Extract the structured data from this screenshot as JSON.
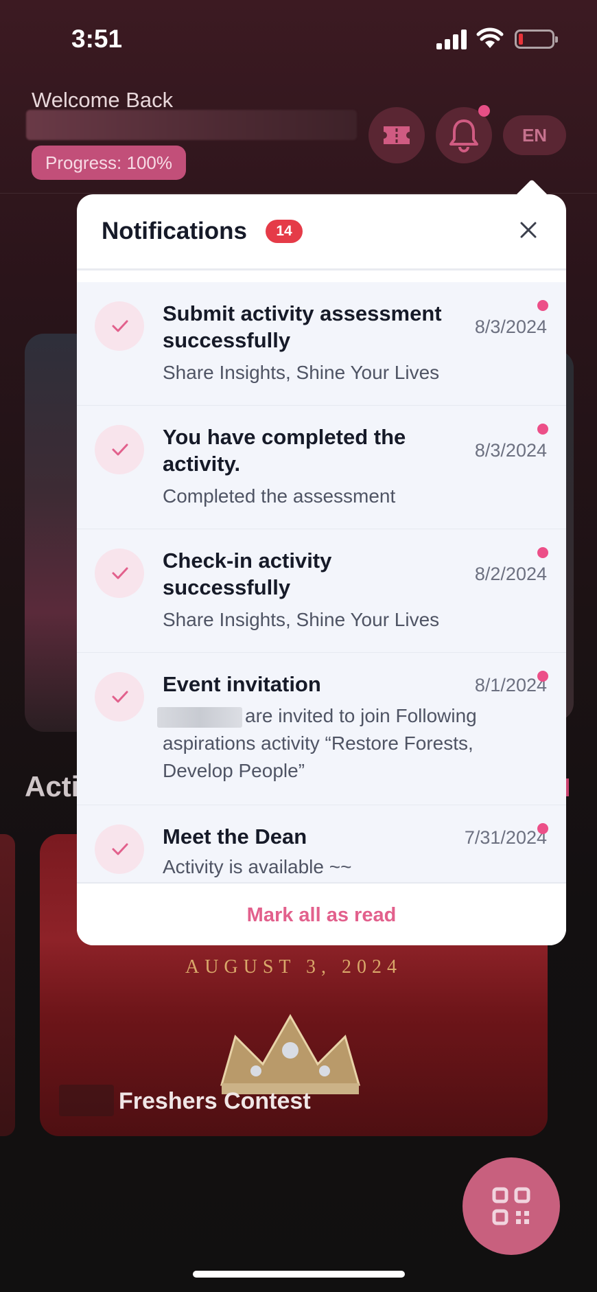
{
  "status_bar": {
    "time": "3:51"
  },
  "header": {
    "welcome": "Welcome Back",
    "progress": "Progress: 100%",
    "language": "EN"
  },
  "background": {
    "section_title": "Acti",
    "event_date": "AUGUST 3, 2024",
    "event_title": "Freshers Contest"
  },
  "notifications": {
    "title": "Notifications",
    "count": "14",
    "items": [
      {
        "title": "Submit activity assessment successfully",
        "date": "8/3/2024",
        "body": "Share Insights, Shine Your Lives",
        "unread": true
      },
      {
        "title": "You have completed the activity.",
        "date": "8/3/2024",
        "body": "Completed the assessment",
        "unread": true
      },
      {
        "title": "Check-in activity successfully",
        "date": "8/2/2024",
        "body": "Share Insights, Shine Your Lives",
        "unread": true
      },
      {
        "title": "Event invitation",
        "date": "8/1/2024",
        "body": "are invited to join Following aspirations activity “Restore Forests, Develop People”",
        "unread": true
      },
      {
        "title": "Meet the Dean",
        "date": "7/31/2024",
        "body": "Activity is available ~~",
        "unread": true
      }
    ],
    "mark_all": "Mark all as read"
  },
  "colors": {
    "accent": "#e2608c",
    "unread_dot": "#ec4f88",
    "badge": "#e53b48",
    "fab": "#c8607e"
  },
  "icons": [
    "ticket-icon",
    "bell-icon",
    "close-icon",
    "check-icon",
    "qr-code-icon",
    "signal-icon",
    "wifi-icon",
    "battery-icon"
  ]
}
